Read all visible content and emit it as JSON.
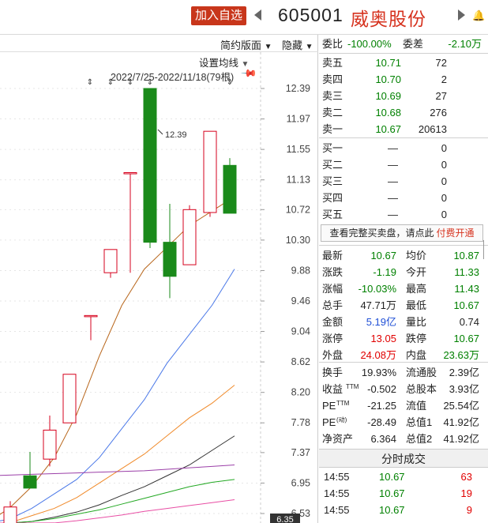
{
  "header": {
    "add_watchlist": "加入自选",
    "code": "605001",
    "name": "威奥股份"
  },
  "chart_toolbar": {
    "layout": "简约版面",
    "hide": "隐藏",
    "ma_settings": "设置均线",
    "range": "2022/7/25-2022/11/18(79根)"
  },
  "chart_data": {
    "type": "candlestick",
    "y_ticks": [
      "12.39",
      "11.97",
      "11.55",
      "11.13",
      "10.72",
      "10.30",
      "9.88",
      "9.46",
      "9.04",
      "8.62",
      "8.20",
      "7.78",
      "7.37",
      "6.95",
      "6.53"
    ],
    "ylim": [
      6.35,
      12.6
    ],
    "low_label": "6.35",
    "high_annotation": "12.39",
    "candles": [
      {
        "open": 6.35,
        "high": 6.7,
        "low": 6.3,
        "close": 6.62
      },
      {
        "open": 7.05,
        "high": 7.38,
        "low": 6.88,
        "close": 6.88
      },
      {
        "open": 7.28,
        "high": 7.88,
        "low": 7.18,
        "close": 7.68
      },
      {
        "open": 7.78,
        "high": 8.45,
        "low": 7.78,
        "close": 8.45
      },
      {
        "open": 9.26,
        "high": 9.26,
        "low": 8.92,
        "close": 9.26
      },
      {
        "open": 9.85,
        "high": 10.17,
        "low": 9.78,
        "close": 10.17
      },
      {
        "open": 11.23,
        "high": 11.23,
        "low": 9.85,
        "close": 11.23
      },
      {
        "open": 12.39,
        "high": 12.39,
        "low": 10.19,
        "close": 10.27
      },
      {
        "open": 10.27,
        "high": 10.8,
        "low": 9.5,
        "close": 9.8
      },
      {
        "open": 9.96,
        "high": 10.78,
        "low": 9.96,
        "close": 10.72
      },
      {
        "open": 10.68,
        "high": 11.8,
        "low": 10.62,
        "close": 11.8
      },
      {
        "open": 11.33,
        "high": 11.43,
        "low": 10.67,
        "close": 10.67
      }
    ],
    "ma_lines": [
      {
        "color": "#b8661b",
        "values": [
          6.4,
          6.6,
          6.9,
          7.3,
          7.9,
          8.7,
          9.4,
          9.9,
          10.2,
          10.5,
          10.7,
          10.9
        ]
      },
      {
        "color": "#4a78e8",
        "values": [
          6.35,
          6.45,
          6.6,
          6.8,
          7.0,
          7.3,
          7.7,
          8.1,
          8.6,
          9.0,
          9.4,
          9.9
        ]
      },
      {
        "color": "#f08a2a",
        "values": [
          6.35,
          6.4,
          6.5,
          6.6,
          6.75,
          6.95,
          7.15,
          7.35,
          7.6,
          7.85,
          8.05,
          8.3
        ]
      },
      {
        "color": "#333333",
        "values": [
          6.35,
          6.38,
          6.42,
          6.48,
          6.55,
          6.65,
          6.78,
          6.9,
          7.05,
          7.2,
          7.4,
          7.6
        ]
      },
      {
        "color": "#9b3fa8",
        "values": [
          7.05,
          7.06,
          7.07,
          7.08,
          7.09,
          7.1,
          7.11,
          7.12,
          7.14,
          7.16,
          7.18,
          7.2
        ]
      },
      {
        "color": "#22a822",
        "values": [
          6.35,
          6.38,
          6.42,
          6.46,
          6.52,
          6.58,
          6.66,
          6.74,
          6.82,
          6.9,
          6.96,
          7.0
        ]
      },
      {
        "color": "#e84ea4",
        "values": [
          6.35,
          6.36,
          6.38,
          6.4,
          6.43,
          6.47,
          6.51,
          6.56,
          6.6,
          6.64,
          6.68,
          6.72
        ]
      }
    ]
  },
  "orderbook": {
    "ratio_label": "委比",
    "ratio_value": "-100.00%",
    "diff_label": "委差",
    "diff_value": "-2.10万",
    "sells": [
      {
        "label": "卖五",
        "price": "10.71",
        "vol": "72"
      },
      {
        "label": "卖四",
        "price": "10.70",
        "vol": "2"
      },
      {
        "label": "卖三",
        "price": "10.69",
        "vol": "27"
      },
      {
        "label": "卖二",
        "price": "10.68",
        "vol": "276"
      },
      {
        "label": "卖一",
        "price": "10.67",
        "vol": "20613"
      }
    ],
    "buys": [
      {
        "label": "买一",
        "price": "—",
        "vol": "0"
      },
      {
        "label": "买二",
        "price": "—",
        "vol": "0"
      },
      {
        "label": "买三",
        "price": "—",
        "vol": "0"
      },
      {
        "label": "买四",
        "price": "—",
        "vol": "0"
      },
      {
        "label": "买五",
        "price": "—",
        "vol": "0"
      }
    ],
    "banner_text": "查看完整买卖盘，请点此",
    "banner_link": "付费开通"
  },
  "stats": [
    {
      "l1": "最新",
      "v1": "10.67",
      "c1": "grn",
      "l2": "均价",
      "v2": "10.87",
      "c2": "grn"
    },
    {
      "l1": "涨跌",
      "v1": "-1.19",
      "c1": "grn",
      "l2": "今开",
      "v2": "11.33",
      "c2": "grn"
    },
    {
      "l1": "涨幅",
      "v1": "-10.03%",
      "c1": "grn",
      "l2": "最高",
      "v2": "11.43",
      "c2": "grn"
    },
    {
      "l1": "总手",
      "v1": "47.71万",
      "c1": "",
      "l2": "最低",
      "v2": "10.67",
      "c2": "grn"
    },
    {
      "l1": "金额",
      "v1": "5.19亿",
      "c1": "blu",
      "l2": "量比",
      "v2": "0.74",
      "c2": ""
    },
    {
      "l1": "涨停",
      "v1": "13.05",
      "c1": "red",
      "l2": "跌停",
      "v2": "10.67",
      "c2": "grn"
    },
    {
      "l1": "外盘",
      "v1": "24.08万",
      "c1": "red",
      "l2": "内盘",
      "v2": "23.63万",
      "c2": "grn"
    }
  ],
  "fundamentals": [
    {
      "l1": "换手",
      "v1": "19.93%",
      "l2": "流通股",
      "v2": "2.39亿"
    },
    {
      "l1": "收益",
      "sup1": "TTM",
      "v1": "-0.502",
      "l2": "总股本",
      "v2": "3.93亿"
    },
    {
      "l1": "PE",
      "sup1": "TTM",
      "v1": "-21.25",
      "l2": "流值",
      "v2": "25.54亿"
    },
    {
      "l1": "PE",
      "sup1": "(动)",
      "v1": "-28.49",
      "l2": "总值1",
      "v2": "41.92亿"
    },
    {
      "l1": "净资产",
      "v1": "6.364",
      "l2": "总值2",
      "v2": "41.92亿"
    }
  ],
  "trades": {
    "title": "分时成交",
    "rows": [
      {
        "time": "14:55",
        "price": "10.67",
        "vol": "63"
      },
      {
        "time": "14:55",
        "price": "10.67",
        "vol": "19"
      },
      {
        "time": "14:55",
        "price": "10.67",
        "vol": "9"
      },
      {
        "time": "14:55",
        "price": "10.67",
        "vol": "35"
      }
    ]
  }
}
